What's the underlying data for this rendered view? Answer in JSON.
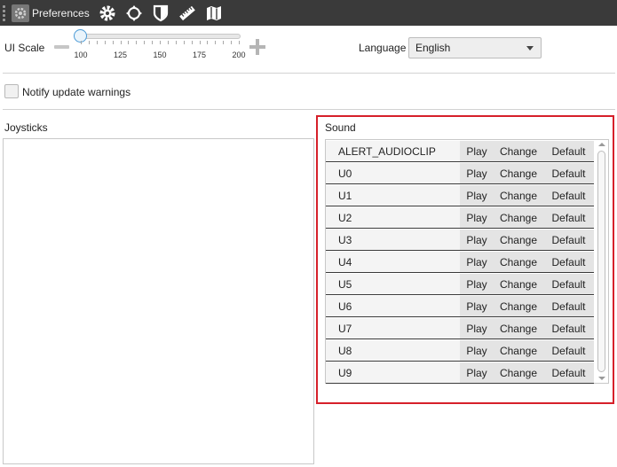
{
  "toolbar": {
    "title": "Preferences",
    "icons": [
      "gear-icon",
      "move-icon",
      "shield-icon",
      "ruler-icon",
      "map-icon"
    ]
  },
  "general": {
    "ui_scale_label": "UI Scale",
    "ui_scale": {
      "value": 100,
      "min": 100,
      "max": 200,
      "ticks": [
        "100",
        "125",
        "150",
        "175",
        "200"
      ]
    },
    "language_label": "Language",
    "language_value": "English",
    "notify_label": "Notify update warnings",
    "notify_checked": false
  },
  "joysticks": {
    "label": "Joysticks"
  },
  "sound": {
    "label": "Sound",
    "highlight_color": "#d6202a",
    "play_label": "Play",
    "change_label": "Change",
    "default_label": "Default",
    "items": [
      {
        "name": "ALERT_AUDIOCLIP"
      },
      {
        "name": "U0"
      },
      {
        "name": "U1"
      },
      {
        "name": "U2"
      },
      {
        "name": "U3"
      },
      {
        "name": "U4"
      },
      {
        "name": "U5"
      },
      {
        "name": "U6"
      },
      {
        "name": "U7"
      },
      {
        "name": "U8"
      },
      {
        "name": "U9"
      }
    ]
  }
}
